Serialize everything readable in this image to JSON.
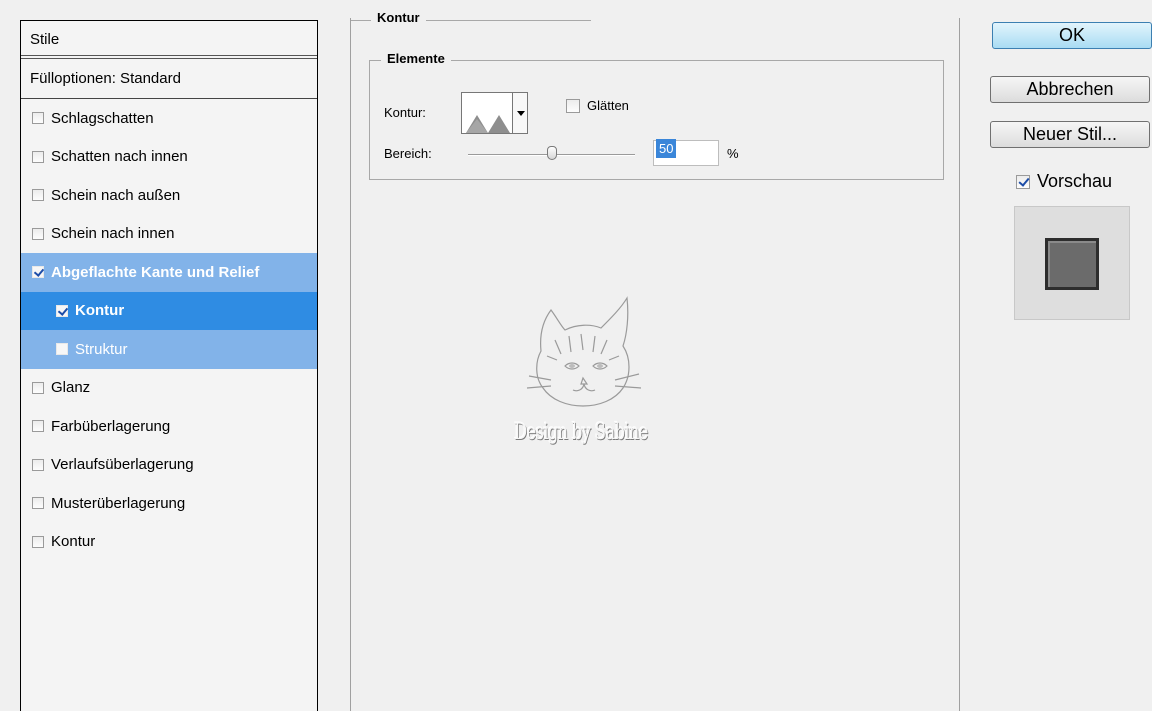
{
  "styles_list": {
    "header": "Stile",
    "fill_options": "Fülloptionen: Standard",
    "items": [
      {
        "label": "Schlagschatten",
        "checked": false
      },
      {
        "label": "Schatten nach innen",
        "checked": false
      },
      {
        "label": "Schein nach außen",
        "checked": false
      },
      {
        "label": "Schein nach innen",
        "checked": false
      },
      {
        "label": "Abgeflachte Kante und Relief",
        "checked": true
      },
      {
        "label": "Kontur",
        "checked": true
      },
      {
        "label": "Struktur",
        "checked": false
      },
      {
        "label": "Glanz",
        "checked": false
      },
      {
        "label": "Farbüberlagerung",
        "checked": false
      },
      {
        "label": "Verlaufsüberlagerung",
        "checked": false
      },
      {
        "label": "Musterüberlagerung",
        "checked": false
      },
      {
        "label": "Kontur",
        "checked": false
      }
    ]
  },
  "main": {
    "group_title": "Kontur",
    "elements_title": "Elemente",
    "contour_label": "Kontur:",
    "smooth_label": "Glätten",
    "smooth_checked": false,
    "range_label": "Bereich:",
    "range_value": "50",
    "range_unit": "%",
    "range_fraction": 0.5,
    "watermark_text": "Design by Sabine"
  },
  "buttons": {
    "ok": "OK",
    "cancel": "Abbrechen",
    "new_style": "Neuer Stil..."
  },
  "preview": {
    "label": "Vorschau",
    "checked": true
  },
  "colors": {
    "selected_parent": "#82b3e9",
    "selected_item": "#2f8ce3",
    "ok_button": "#a9dcf3"
  }
}
